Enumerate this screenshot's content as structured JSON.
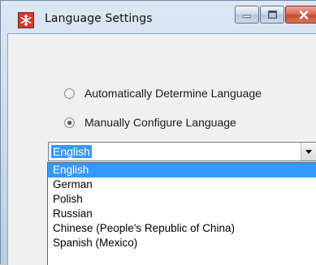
{
  "window": {
    "title": "Language Settings",
    "icon": "snowflake-icon",
    "controls": [
      "minimize-icon",
      "maximize-icon",
      "close-icon"
    ]
  },
  "language_mode": {
    "options": [
      {
        "label": "Automatically Determine Language",
        "checked": false
      },
      {
        "label": "Manually Configure Language",
        "checked": true
      }
    ]
  },
  "language_select": {
    "value": "English",
    "options": [
      "English",
      "German",
      "Polish",
      "Russian",
      "Chinese (People's Republic of China)",
      "Spanish (Mexico)"
    ],
    "highlighted_index": 0
  },
  "colors": {
    "selection": "#3399ff",
    "app_icon": "#cf3b31",
    "close_button": "#c74a2f"
  }
}
